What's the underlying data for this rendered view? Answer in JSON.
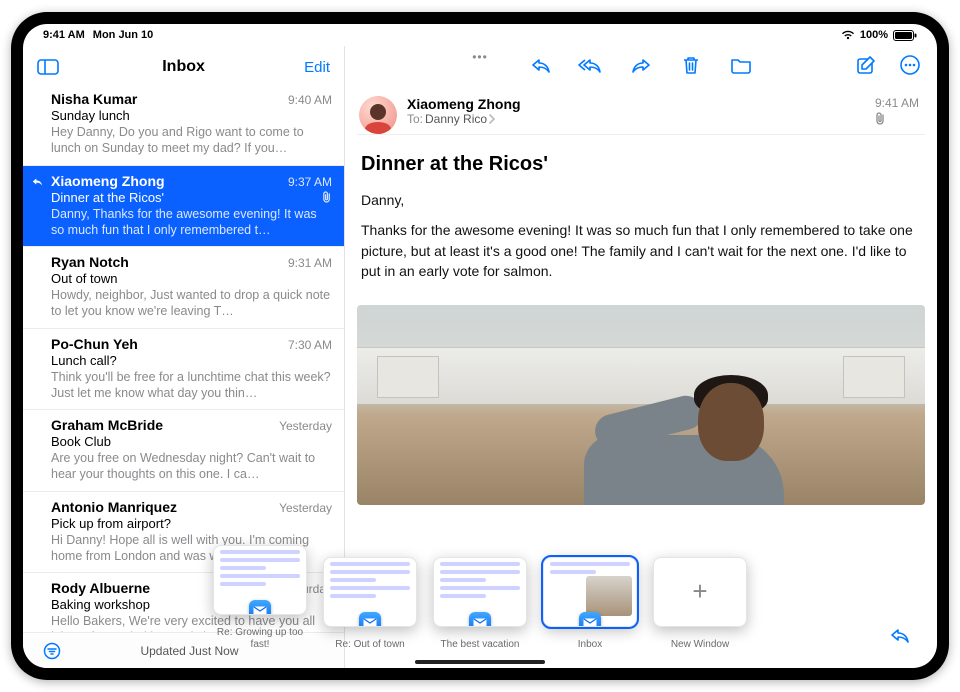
{
  "status": {
    "time": "9:41 AM",
    "date": "Mon Jun 10",
    "battery": "100%"
  },
  "sidebar": {
    "title": "Inbox",
    "edit": "Edit",
    "selectedIndex": 1,
    "items": [
      {
        "sender": "Nisha Kumar",
        "time": "9:40 AM",
        "subject": "Sunday lunch",
        "preview": "Hey Danny, Do you and Rigo want to come to lunch on Sunday to meet my dad? If you…"
      },
      {
        "sender": "Xiaomeng Zhong",
        "time": "9:37 AM",
        "subject": "Dinner at the Ricos'",
        "preview": "Danny, Thanks for the awesome evening! It was so much fun that I only remembered t…",
        "replied": true,
        "attachment": true
      },
      {
        "sender": "Ryan Notch",
        "time": "9:31 AM",
        "subject": "Out of town",
        "preview": "Howdy, neighbor, Just wanted to drop a quick note to let you know we're leaving T…"
      },
      {
        "sender": "Po-Chun Yeh",
        "time": "7:30 AM",
        "subject": "Lunch call?",
        "preview": "Think you'll be free for a lunchtime chat this week? Just let me know what day you thin…"
      },
      {
        "sender": "Graham McBride",
        "time": "Yesterday",
        "subject": "Book Club",
        "preview": "Are you free on Wednesday night? Can't wait to hear your thoughts on this one. I ca…"
      },
      {
        "sender": "Antonio Manriquez",
        "time": "Yesterday",
        "subject": "Pick up from airport?",
        "preview": "Hi Danny! Hope all is well with you. I'm coming home from London and was wond…"
      },
      {
        "sender": "Rody Albuerne",
        "time": "Saturday",
        "subject": "Baking workshop",
        "preview": "Hello Bakers, We're very excited to have you all join us for our baking workshop…"
      }
    ],
    "footer": {
      "updated": "Updated Just Now"
    }
  },
  "message": {
    "from": "Xiaomeng Zhong",
    "toLabel": "To:",
    "toName": "Danny Rico",
    "time": "9:41 AM",
    "subject": "Dinner at the Ricos'",
    "greeting": "Danny,",
    "body": "Thanks for the awesome evening! It was so much fun that I only remembered to take one picture, but at least it's a good one! The family and I can't wait for the next one. I'd like to put in an early vote for salmon."
  },
  "shelf": {
    "items": [
      {
        "label": "Re: Growing up too fast!"
      },
      {
        "label": "Re: Out of town"
      },
      {
        "label": "The best vacation"
      },
      {
        "label": "Inbox",
        "selected": true,
        "hasPhoto": true
      },
      {
        "label": "New Window",
        "isNew": true
      }
    ]
  }
}
